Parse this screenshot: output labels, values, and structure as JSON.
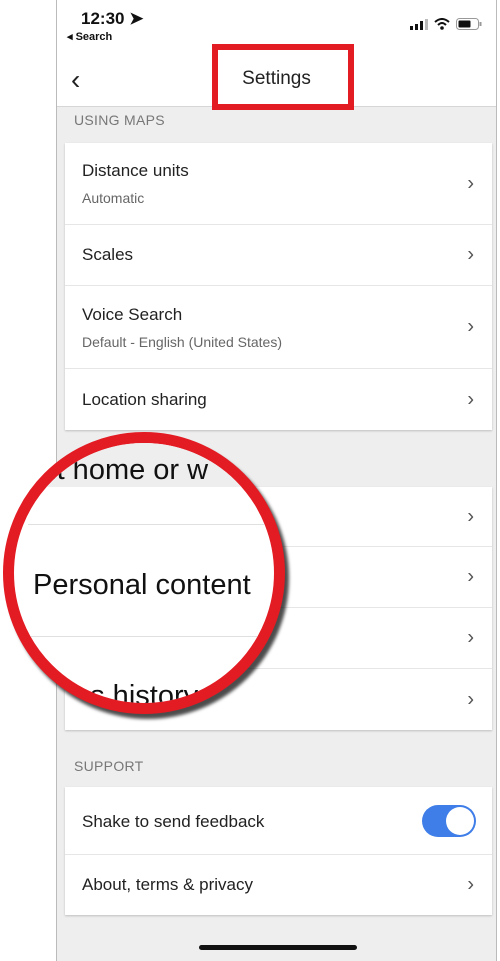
{
  "status": {
    "time": "12:30",
    "back_app": "◂ Search"
  },
  "nav": {
    "title": "Settings"
  },
  "using_maps": {
    "header": "USING MAPS",
    "items": [
      {
        "label": "Distance units",
        "sub": "Automatic"
      },
      {
        "label": "Scales"
      },
      {
        "label": "Voice Search",
        "sub": "Default - English (United States)"
      },
      {
        "label": "Location sharing"
      }
    ]
  },
  "magnifier": {
    "line1": "ult home or w",
    "line2": "Personal content",
    "line3": "ps history"
  },
  "support": {
    "header": "SUPPORT",
    "items": [
      {
        "label": "Shake to send feedback",
        "toggle": true
      },
      {
        "label": "About, terms & privacy"
      }
    ]
  },
  "colors": {
    "highlight": "#e31b23",
    "toggle": "#3f7ee8"
  }
}
